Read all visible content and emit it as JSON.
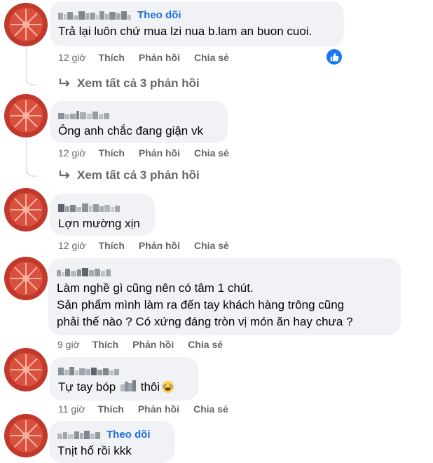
{
  "comments": [
    {
      "follow_label": "Theo dõi",
      "text": "Trả lại luôn chứ mua lzi nua b.lam an buon cuoi.",
      "time": "12 giờ",
      "like": "Thích",
      "reply": "Phản hồi",
      "share": "Chia sẻ",
      "see_replies": "Xem tất cả 3 phản hồi",
      "reaction_icon": "like-icon"
    },
    {
      "text": "Ông anh chắc đang giận vk",
      "time": "12 giờ",
      "like": "Thích",
      "reply": "Phản hồi",
      "share": "Chia sẻ",
      "see_replies": "Xem tất cả 3 phản hồi"
    },
    {
      "text": "Lợn mường xịn",
      "time": "12 giờ",
      "like": "Thích",
      "reply": "Phản hồi",
      "share": "Chia sẻ"
    },
    {
      "text_lines": [
        "Làm nghề gì cũng nên có tâm 1 chút.",
        "Sản phẩm mình làm ra đến tay khách hàng trông cũng",
        "phải thế nào ? Có xứng đáng tròn vị món ăn hay chưa ?"
      ],
      "time": "9 giờ",
      "like": "Thích",
      "reply": "Phản hồi",
      "share": "Chia sẻ"
    },
    {
      "text_before": "Tự tay bóp",
      "text_after": "thôi",
      "emoji_icon": "laughing-emoji-icon",
      "time": "11 giờ",
      "like": "Thích",
      "reply": "Phản hồi",
      "share": "Chia sẻ"
    },
    {
      "follow_label": "Theo dõi",
      "text": "Tnịt hổ rồi kkk"
    }
  ],
  "colors": {
    "bubble": "#f0f2f5",
    "follow": "#216fdb",
    "meta": "#65676b",
    "avatar": "#c0392b",
    "like_badge": "#1877f2"
  }
}
